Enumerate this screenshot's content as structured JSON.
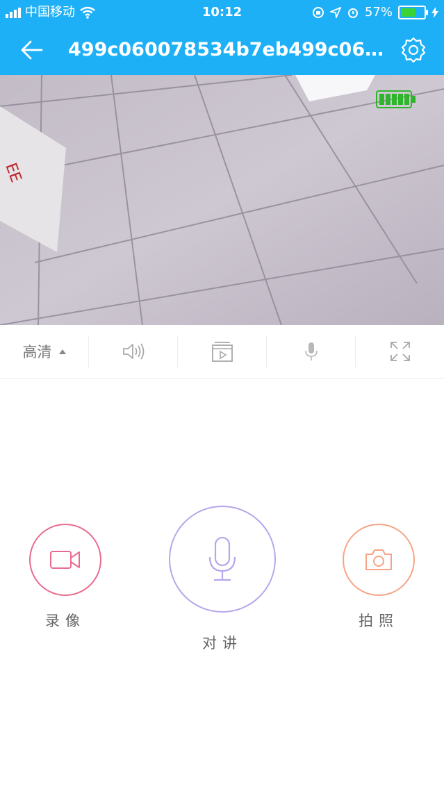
{
  "status_bar": {
    "carrier": "中国移动",
    "time": "10:12",
    "battery_percent": "57%",
    "battery_level": 0.57
  },
  "header": {
    "title": "499c060078534b7eb499c060...",
    "back_icon": "arrow-left-icon",
    "settings_icon": "gear-icon"
  },
  "video": {
    "battery_indicator": "battery-full-icon"
  },
  "toolbar": {
    "quality_label": "高清",
    "sound_icon": "speaker-icon",
    "playback_icon": "video-playback-icon",
    "mic_icon": "microphone-icon",
    "fullscreen_icon": "fullscreen-icon"
  },
  "actions": {
    "record_label": "录像",
    "talk_label": "对讲",
    "photo_label": "拍照"
  },
  "colors": {
    "header_bg": "#1eb0f6",
    "record": "#ea6b8d",
    "talk": "#b7a6ea",
    "photo": "#f5a486",
    "cam_battery": "#2fb52c"
  }
}
